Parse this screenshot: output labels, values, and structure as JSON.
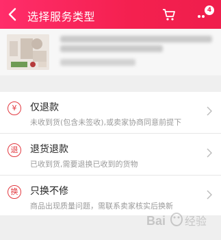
{
  "header": {
    "title": "选择服务类型",
    "badge_count": "4",
    "icons": {
      "back": "back-arrow-icon",
      "cart": "cart-icon",
      "more": "more-icon"
    }
  },
  "product": {
    "image": "product-thumbnail"
  },
  "options": [
    {
      "label": "仅退款",
      "description": "未收到货(包含未签收),或卖家协商同意前提下",
      "icon_char": "¥"
    },
    {
      "label": "退货退款",
      "description": "已收到货,需要退换已收到的货物",
      "icon_char": "退"
    },
    {
      "label": "只换不修",
      "description": "商品出现质量问题，需联系卖家核实后换新",
      "icon_char": "换"
    }
  ],
  "colors": {
    "accent": "#ef1e4c",
    "icon_red": "#e2383f"
  },
  "watermark": {
    "text": "Bai 经验"
  }
}
